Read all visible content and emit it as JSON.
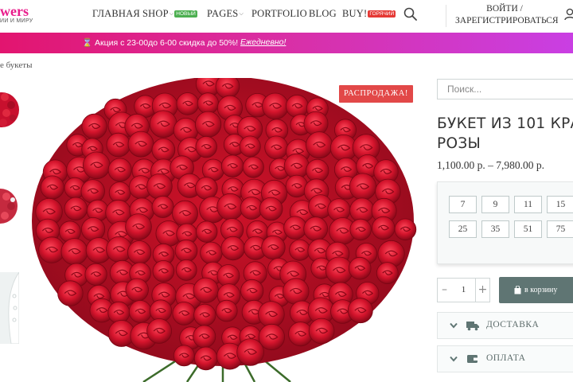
{
  "header": {
    "logo_text": "wers",
    "logo_tagline": "ИИ И МИРУ",
    "nav": [
      {
        "label": "ГЛАВНАЯ"
      },
      {
        "label": "SHOP",
        "badge": "НОВЫЙ",
        "badge_color": "#4caf50"
      },
      {
        "label": "PAGES"
      },
      {
        "label": "PORTFOLIO"
      },
      {
        "label": "BLOG"
      },
      {
        "label": "BUY!",
        "badge": "ГОРЯЧИЙ",
        "badge_color": "#e53935"
      }
    ],
    "search_icon": "search-icon",
    "login_line1": "ВОЙТИ /",
    "login_line2": "ЗАРЕГИСТРИРОВАТЬСЯ",
    "user_icon": "user-icon"
  },
  "promo": {
    "text": "⌛ Акция с 23-00до 6-00 скидка до 50%!",
    "link": "Ежедневно!"
  },
  "breadcrumb": "е букеты",
  "product": {
    "sale_badge": "РАСПРОДАЖА!",
    "title_line1": "БУКЕТ ИЗ 101 КРА",
    "title_line2": "РОЗЫ",
    "price": "1,100.00 р. – 7,980.00 р.",
    "variants": [
      "7",
      "9",
      "11",
      "15",
      "25",
      "35",
      "51",
      "75"
    ],
    "quantity": "1",
    "cart_label": "в корзину"
  },
  "sidebar": {
    "search_placeholder": "Поиск..."
  },
  "accordion": [
    {
      "label": "ДОСТАВКА",
      "icon": "truck-icon"
    },
    {
      "label": "ОПЛАТА",
      "icon": "wallet-icon"
    }
  ],
  "colors": {
    "accent": "#e91e8c",
    "button": "#5f7573",
    "sale": "#e24848",
    "rose": "#c8102e"
  }
}
